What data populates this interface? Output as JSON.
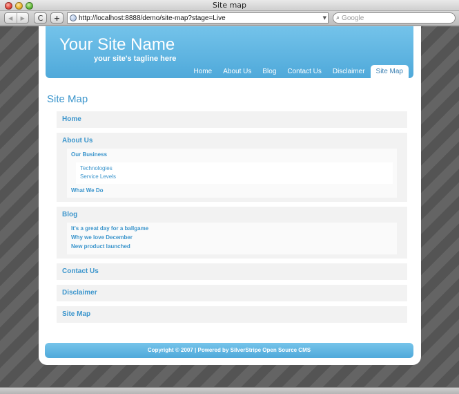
{
  "window": {
    "title": "Site map"
  },
  "toolbar": {
    "back_glyph": "◀",
    "forward_glyph": "▶",
    "reload_glyph": "C",
    "add_glyph": "+",
    "url": "http://localhost:8888/demo/site-map?stage=Live",
    "search_placeholder": "Google"
  },
  "header": {
    "site_name": "Your Site Name",
    "tagline": "your site's tagline here",
    "nav": [
      "Home",
      "About Us",
      "Blog",
      "Contact Us",
      "Disclaimer",
      "Site Map"
    ],
    "active_nav": "Site Map"
  },
  "main": {
    "title": "Site Map",
    "sitemap": {
      "home": "Home",
      "about": {
        "label": "About Us",
        "children": {
          "our_business": "Our Business",
          "our_business_children": [
            "Technologies",
            "Service Levels"
          ],
          "what_we_do": "What We Do"
        }
      },
      "blog": {
        "label": "Blog",
        "posts": [
          "It's a great day for a ballgame",
          "Why we love December",
          "New product launched"
        ]
      },
      "contact": "Contact Us",
      "disclaimer": "Disclaimer",
      "sitemap": "Site Map"
    }
  },
  "footer": {
    "text": "Copyright © 2007 | Powered by SilverStripe Open Source CMS"
  },
  "colors": {
    "accent": "#4fa9da",
    "link": "#3b95cc",
    "box": "#f2f2f2"
  }
}
